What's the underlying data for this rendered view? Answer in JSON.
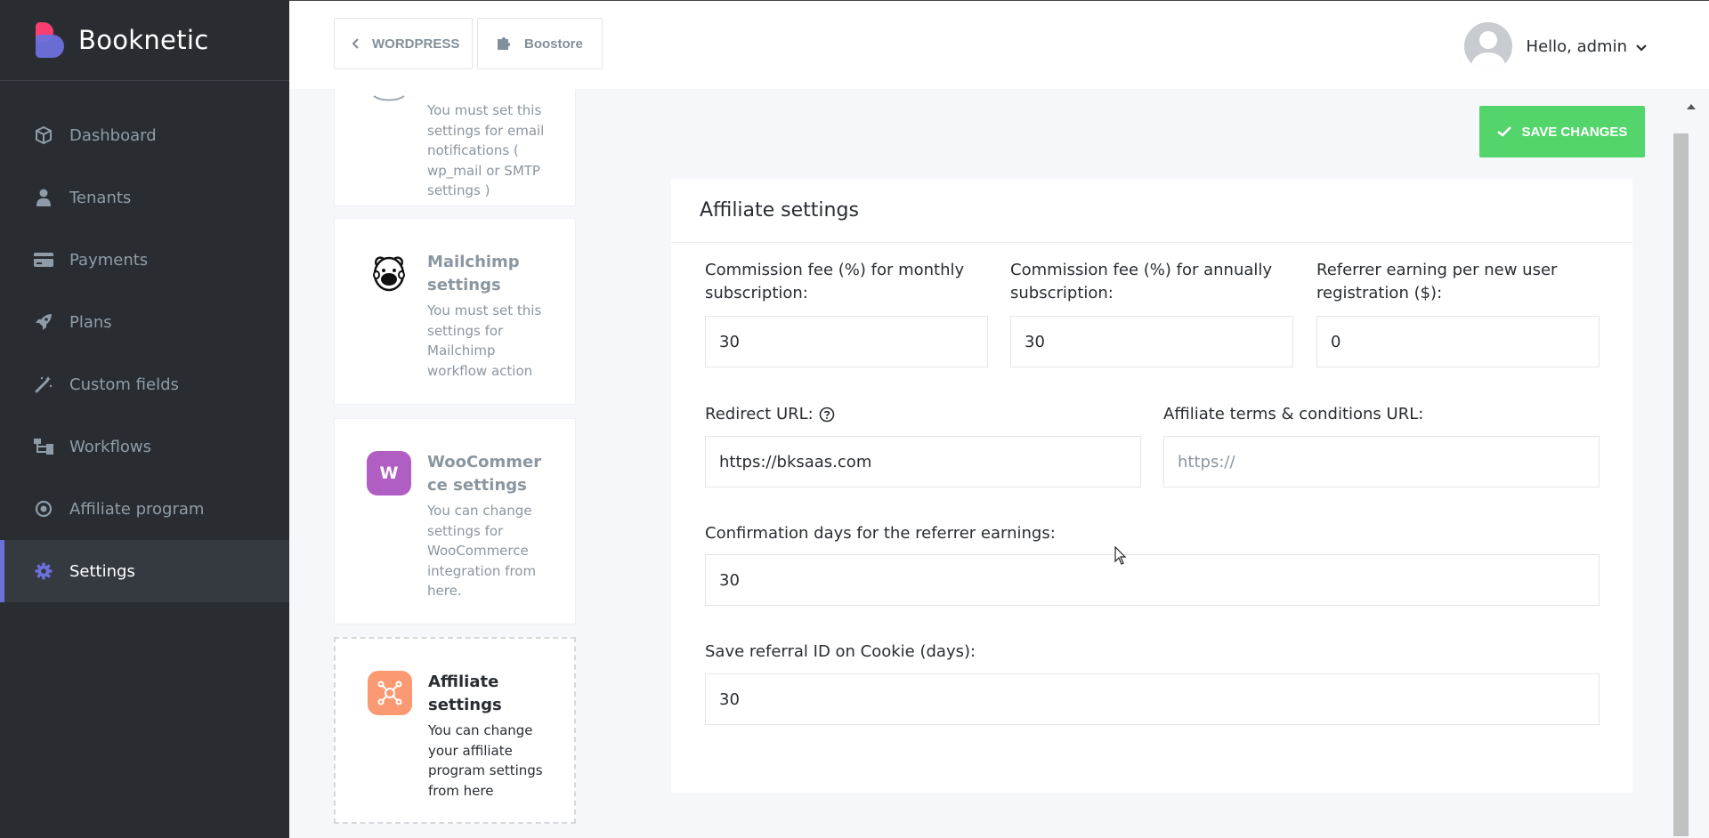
{
  "brand": {
    "name": "Booknetic"
  },
  "sidebar": {
    "items": [
      {
        "label": "Dashboard",
        "icon": "cube-icon"
      },
      {
        "label": "Tenants",
        "icon": "user-icon"
      },
      {
        "label": "Payments",
        "icon": "credit-card-icon"
      },
      {
        "label": "Plans",
        "icon": "rocket-icon"
      },
      {
        "label": "Custom fields",
        "icon": "magic-wand-icon"
      },
      {
        "label": "Workflows",
        "icon": "workflow-icon"
      },
      {
        "label": "Affiliate program",
        "icon": "target-icon"
      },
      {
        "label": "Settings",
        "icon": "gear-icon",
        "active": true
      }
    ]
  },
  "topbar": {
    "wordpress_label": "WORDPRESS",
    "boostore_label": "Boostore",
    "greeting": "Hello, admin"
  },
  "cards": [
    {
      "title": "",
      "desc": "You must set this settings for email notifications ( wp_mail or SMTP settings )"
    },
    {
      "title": "Mailchimp settings",
      "desc": "You must set this settings for Mailchimp workflow action",
      "icon": "mailchimp-icon"
    },
    {
      "title": "WooCommerce settings",
      "desc": "You can change settings for WooCommerce integration from here.",
      "icon": "woocommerce-icon",
      "icon_letter": "W",
      "color": "#b05ec3"
    },
    {
      "title": "Affiliate settings",
      "desc": "You can change your affiliate program settings from here",
      "icon": "affiliate-icon",
      "color": "#fb9a72",
      "active": true
    }
  ],
  "main": {
    "save_label": "SAVE CHANGES",
    "panel_title": "Affiliate settings",
    "fields": {
      "monthly": {
        "label": "Commission fee (%) for monthly subscription:",
        "value": "30"
      },
      "annually": {
        "label": "Commission fee (%) for annually subscription:",
        "value": "30"
      },
      "referrer": {
        "label": "Referrer earning per new user registration ($):",
        "value": "0"
      },
      "redirect": {
        "label": "Redirect URL:",
        "value": "https://bksaas.com"
      },
      "terms": {
        "label": "Affiliate terms & conditions URL:",
        "value": "",
        "placeholder": "https://"
      },
      "confirmation": {
        "label": "Confirmation days for the referrer earnings:",
        "value": "30"
      },
      "cookie": {
        "label": "Save referral ID on Cookie (days):",
        "value": "30"
      }
    }
  },
  "colors": {
    "accent": "#6c70dc",
    "save": "#53d56c",
    "sidebar": "#292d32"
  }
}
